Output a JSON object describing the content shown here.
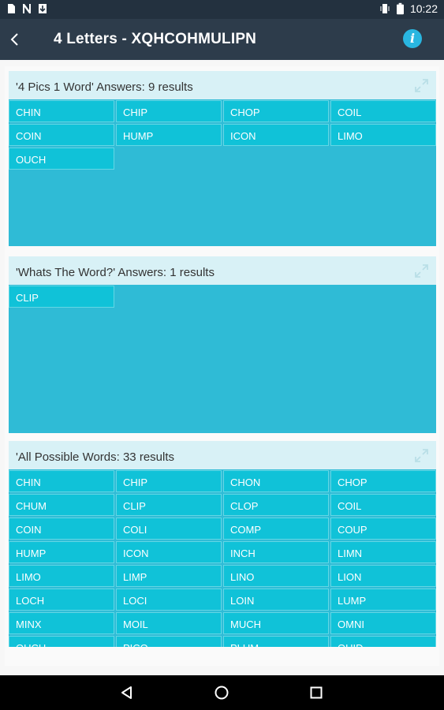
{
  "status_bar": {
    "time": "10:22",
    "left_icons": [
      "notification-icon",
      "n-icon",
      "download-icon"
    ],
    "right_icons": [
      "vibrate-icon",
      "battery-icon"
    ]
  },
  "app_bar": {
    "title": "4 Letters - XQHCOHMULIPN",
    "back_icon": "arrow-back-icon",
    "info_icon": "info-icon",
    "info_glyph": "i"
  },
  "sections": [
    {
      "header": "'4 Pics 1 Word' Answers: 9 results",
      "words": [
        "CHIN",
        "CHIP",
        "CHOP",
        "COIL",
        "COIN",
        "HUMP",
        "ICON",
        "LIMO",
        "OUCH"
      ]
    },
    {
      "header": "'Whats The Word?' Answers: 1 results",
      "words": [
        "CLIP"
      ]
    },
    {
      "header": "'All Possible Words: 33 results",
      "words": [
        "CHIN",
        "CHIP",
        "CHON",
        "CHOP",
        "CHUM",
        "CLIP",
        "CLOP",
        "COIL",
        "COIN",
        "COLI",
        "COMP",
        "COUP",
        "HUMP",
        "ICON",
        "INCH",
        "LIMN",
        "LIMO",
        "LIMP",
        "LINO",
        "LION",
        "LOCH",
        "LOCI",
        "LOIN",
        "LUMP",
        "MINX",
        "MOIL",
        "MUCH",
        "OMNI",
        "OUCH",
        "PICO",
        "PLUM",
        "QUID"
      ]
    }
  ],
  "colors": {
    "status_bar": "#23313f",
    "app_bar": "#2d3c4b",
    "section_header": "#d8f1f6",
    "section_body": "#2fbbd6",
    "cell": "#10c2d8",
    "accent": "#29b6e0"
  }
}
